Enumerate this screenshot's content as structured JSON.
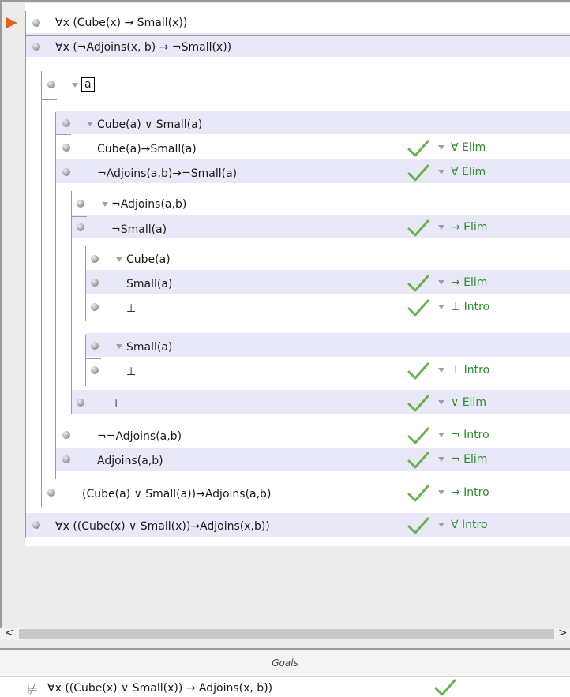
{
  "proof": {
    "premises": [
      "∀x (Cube(x) → Small(x))",
      "∀x (¬Adjoins(x, b) → ¬Small(x))"
    ],
    "boxed_constant": "a",
    "steps": [
      {
        "text": "Cube(a) ∨ Small(a)",
        "rule": ""
      },
      {
        "text": "Cube(a)→Small(a)",
        "rule": "∀ Elim"
      },
      {
        "text": "¬Adjoins(a,b)→¬Small(a)",
        "rule": "∀ Elim"
      },
      {
        "text": "¬Adjoins(a,b)",
        "rule": ""
      },
      {
        "text": "¬Small(a)",
        "rule": "→ Elim"
      },
      {
        "text": "Cube(a)",
        "rule": ""
      },
      {
        "text": "Small(a)",
        "rule": "→ Elim"
      },
      {
        "text": "⊥",
        "rule": "⊥ Intro"
      },
      {
        "text": "Small(a)",
        "rule": ""
      },
      {
        "text": "⊥",
        "rule": "⊥ Intro"
      },
      {
        "text": "⊥",
        "rule": "∨ Elim"
      },
      {
        "text": "¬¬Adjoins(a,b)",
        "rule": "¬ Intro"
      },
      {
        "text": "Adjoins(a,b)",
        "rule": "¬ Elim"
      },
      {
        "text": "(Cube(a) ∨ Small(a))→Adjoins(a,b)",
        "rule": "→ Intro"
      },
      {
        "text": "∀x ((Cube(x) ∨ Small(x))→Adjoins(x,b))",
        "rule": "∀ Intro"
      }
    ]
  },
  "scrollbar": {
    "left_arrow": "<",
    "right_arrow": ">"
  },
  "goals": {
    "title": "Goals",
    "icon": "⊭",
    "goal_text": "∀x ((Cube(x) ∨ Small(x)) → Adjoins(x, b))"
  }
}
